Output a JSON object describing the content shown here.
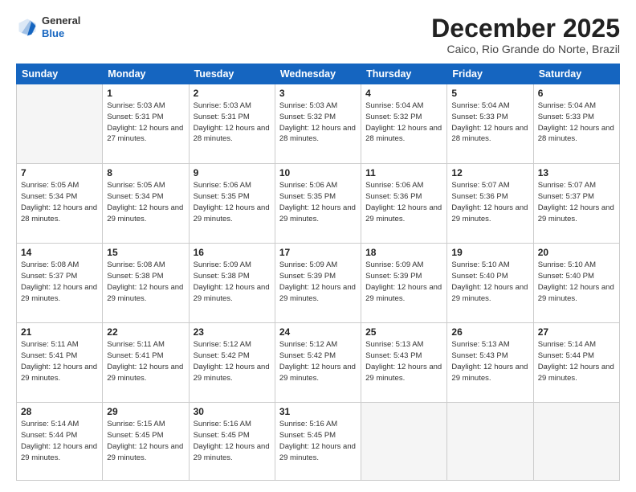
{
  "header": {
    "logo_general": "General",
    "logo_blue": "Blue",
    "month_title": "December 2025",
    "location": "Caico, Rio Grande do Norte, Brazil"
  },
  "weekdays": [
    "Sunday",
    "Monday",
    "Tuesday",
    "Wednesday",
    "Thursday",
    "Friday",
    "Saturday"
  ],
  "weeks": [
    [
      {
        "day": "",
        "empty": true
      },
      {
        "day": "1",
        "sunrise": "Sunrise: 5:03 AM",
        "sunset": "Sunset: 5:31 PM",
        "daylight": "Daylight: 12 hours and 27 minutes."
      },
      {
        "day": "2",
        "sunrise": "Sunrise: 5:03 AM",
        "sunset": "Sunset: 5:31 PM",
        "daylight": "Daylight: 12 hours and 28 minutes."
      },
      {
        "day": "3",
        "sunrise": "Sunrise: 5:03 AM",
        "sunset": "Sunset: 5:32 PM",
        "daylight": "Daylight: 12 hours and 28 minutes."
      },
      {
        "day": "4",
        "sunrise": "Sunrise: 5:04 AM",
        "sunset": "Sunset: 5:32 PM",
        "daylight": "Daylight: 12 hours and 28 minutes."
      },
      {
        "day": "5",
        "sunrise": "Sunrise: 5:04 AM",
        "sunset": "Sunset: 5:33 PM",
        "daylight": "Daylight: 12 hours and 28 minutes."
      },
      {
        "day": "6",
        "sunrise": "Sunrise: 5:04 AM",
        "sunset": "Sunset: 5:33 PM",
        "daylight": "Daylight: 12 hours and 28 minutes."
      }
    ],
    [
      {
        "day": "7",
        "sunrise": "Sunrise: 5:05 AM",
        "sunset": "Sunset: 5:34 PM",
        "daylight": "Daylight: 12 hours and 28 minutes."
      },
      {
        "day": "8",
        "sunrise": "Sunrise: 5:05 AM",
        "sunset": "Sunset: 5:34 PM",
        "daylight": "Daylight: 12 hours and 29 minutes."
      },
      {
        "day": "9",
        "sunrise": "Sunrise: 5:06 AM",
        "sunset": "Sunset: 5:35 PM",
        "daylight": "Daylight: 12 hours and 29 minutes."
      },
      {
        "day": "10",
        "sunrise": "Sunrise: 5:06 AM",
        "sunset": "Sunset: 5:35 PM",
        "daylight": "Daylight: 12 hours and 29 minutes."
      },
      {
        "day": "11",
        "sunrise": "Sunrise: 5:06 AM",
        "sunset": "Sunset: 5:36 PM",
        "daylight": "Daylight: 12 hours and 29 minutes."
      },
      {
        "day": "12",
        "sunrise": "Sunrise: 5:07 AM",
        "sunset": "Sunset: 5:36 PM",
        "daylight": "Daylight: 12 hours and 29 minutes."
      },
      {
        "day": "13",
        "sunrise": "Sunrise: 5:07 AM",
        "sunset": "Sunset: 5:37 PM",
        "daylight": "Daylight: 12 hours and 29 minutes."
      }
    ],
    [
      {
        "day": "14",
        "sunrise": "Sunrise: 5:08 AM",
        "sunset": "Sunset: 5:37 PM",
        "daylight": "Daylight: 12 hours and 29 minutes."
      },
      {
        "day": "15",
        "sunrise": "Sunrise: 5:08 AM",
        "sunset": "Sunset: 5:38 PM",
        "daylight": "Daylight: 12 hours and 29 minutes."
      },
      {
        "day": "16",
        "sunrise": "Sunrise: 5:09 AM",
        "sunset": "Sunset: 5:38 PM",
        "daylight": "Daylight: 12 hours and 29 minutes."
      },
      {
        "day": "17",
        "sunrise": "Sunrise: 5:09 AM",
        "sunset": "Sunset: 5:39 PM",
        "daylight": "Daylight: 12 hours and 29 minutes."
      },
      {
        "day": "18",
        "sunrise": "Sunrise: 5:09 AM",
        "sunset": "Sunset: 5:39 PM",
        "daylight": "Daylight: 12 hours and 29 minutes."
      },
      {
        "day": "19",
        "sunrise": "Sunrise: 5:10 AM",
        "sunset": "Sunset: 5:40 PM",
        "daylight": "Daylight: 12 hours and 29 minutes."
      },
      {
        "day": "20",
        "sunrise": "Sunrise: 5:10 AM",
        "sunset": "Sunset: 5:40 PM",
        "daylight": "Daylight: 12 hours and 29 minutes."
      }
    ],
    [
      {
        "day": "21",
        "sunrise": "Sunrise: 5:11 AM",
        "sunset": "Sunset: 5:41 PM",
        "daylight": "Daylight: 12 hours and 29 minutes."
      },
      {
        "day": "22",
        "sunrise": "Sunrise: 5:11 AM",
        "sunset": "Sunset: 5:41 PM",
        "daylight": "Daylight: 12 hours and 29 minutes."
      },
      {
        "day": "23",
        "sunrise": "Sunrise: 5:12 AM",
        "sunset": "Sunset: 5:42 PM",
        "daylight": "Daylight: 12 hours and 29 minutes."
      },
      {
        "day": "24",
        "sunrise": "Sunrise: 5:12 AM",
        "sunset": "Sunset: 5:42 PM",
        "daylight": "Daylight: 12 hours and 29 minutes."
      },
      {
        "day": "25",
        "sunrise": "Sunrise: 5:13 AM",
        "sunset": "Sunset: 5:43 PM",
        "daylight": "Daylight: 12 hours and 29 minutes."
      },
      {
        "day": "26",
        "sunrise": "Sunrise: 5:13 AM",
        "sunset": "Sunset: 5:43 PM",
        "daylight": "Daylight: 12 hours and 29 minutes."
      },
      {
        "day": "27",
        "sunrise": "Sunrise: 5:14 AM",
        "sunset": "Sunset: 5:44 PM",
        "daylight": "Daylight: 12 hours and 29 minutes."
      }
    ],
    [
      {
        "day": "28",
        "sunrise": "Sunrise: 5:14 AM",
        "sunset": "Sunset: 5:44 PM",
        "daylight": "Daylight: 12 hours and 29 minutes."
      },
      {
        "day": "29",
        "sunrise": "Sunrise: 5:15 AM",
        "sunset": "Sunset: 5:45 PM",
        "daylight": "Daylight: 12 hours and 29 minutes."
      },
      {
        "day": "30",
        "sunrise": "Sunrise: 5:16 AM",
        "sunset": "Sunset: 5:45 PM",
        "daylight": "Daylight: 12 hours and 29 minutes."
      },
      {
        "day": "31",
        "sunrise": "Sunrise: 5:16 AM",
        "sunset": "Sunset: 5:45 PM",
        "daylight": "Daylight: 12 hours and 29 minutes."
      },
      {
        "day": "",
        "empty": true
      },
      {
        "day": "",
        "empty": true
      },
      {
        "day": "",
        "empty": true
      }
    ]
  ]
}
